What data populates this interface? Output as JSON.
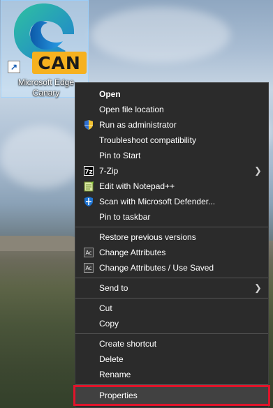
{
  "desktop_icon": {
    "label_line1": "Microsoft Edge",
    "label_line2": "Canary",
    "badge": "CAN",
    "icon_name": "edge-canary-icon"
  },
  "menu": {
    "items": [
      {
        "label": "Open",
        "bold": true
      },
      {
        "label": "Open file location"
      },
      {
        "label": "Run as administrator",
        "icon": "uac-shield-icon"
      },
      {
        "label": "Troubleshoot compatibility"
      },
      {
        "label": "Pin to Start"
      },
      {
        "label": "7-Zip",
        "icon": "7zip-icon",
        "submenu": true
      },
      {
        "label": "Edit with Notepad++",
        "icon": "notepadpp-icon"
      },
      {
        "label": "Scan with Microsoft Defender...",
        "icon": "defender-icon"
      },
      {
        "label": "Pin to taskbar"
      },
      {
        "label": "Restore previous versions"
      },
      {
        "label": "Change Attributes",
        "icon": "attributes-icon"
      },
      {
        "label": "Change Attributes / Use Saved",
        "icon": "attributes-icon"
      },
      {
        "label": "Send to",
        "submenu": true
      },
      {
        "label": "Cut"
      },
      {
        "label": "Copy"
      },
      {
        "label": "Create shortcut"
      },
      {
        "label": "Delete"
      },
      {
        "label": "Rename"
      },
      {
        "label": "Properties",
        "highlighted": true
      }
    ]
  },
  "colors": {
    "menu_bg": "#2b2b2b",
    "highlight_border": "#e0142b",
    "badge": "#f6b11f"
  }
}
